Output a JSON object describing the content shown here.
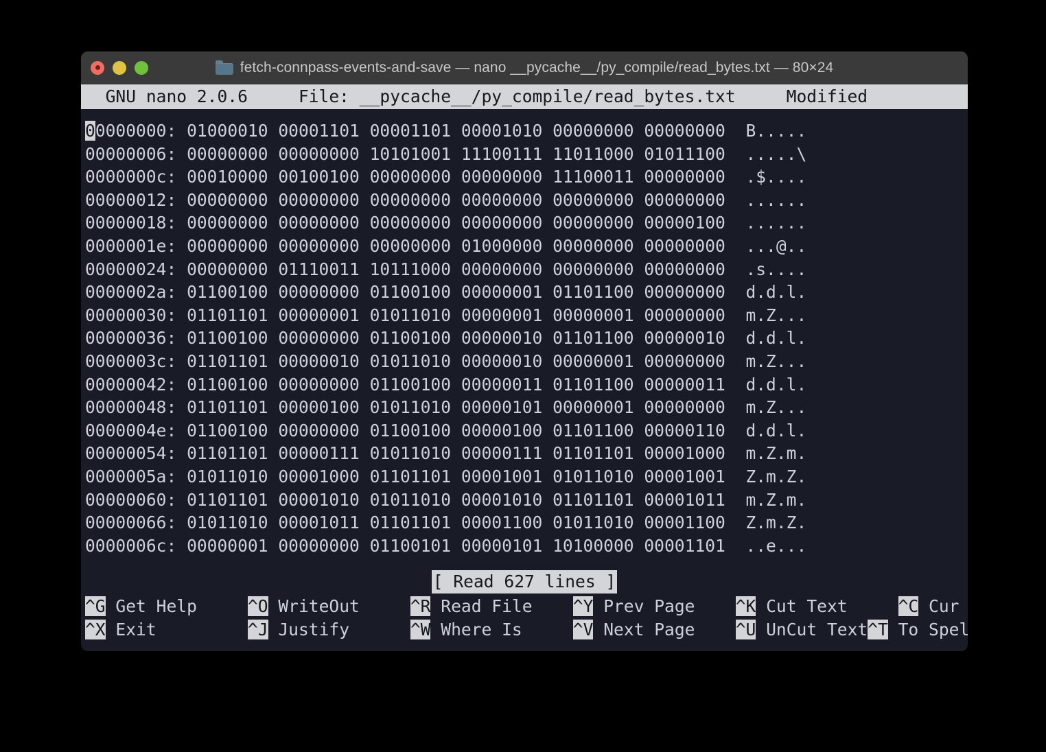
{
  "window": {
    "title": "fetch-connpass-events-and-save — nano __pycache__/py_compile/read_bytes.txt — 80×24",
    "folder_icon": "folder-icon",
    "buttons": {
      "close": "close-button",
      "minimize": "minimize-button",
      "maximize": "maximize-button"
    }
  },
  "nano": {
    "header": {
      "version": "GNU nano 2.0.6",
      "file_label": "File: __pycache__/py_compile/read_bytes.txt",
      "modified": "Modified",
      "full": "  GNU nano 2.0.6     File: __pycache__/py_compile/read_bytes.txt     Modified "
    },
    "status_message": "[ Read 627 lines ]",
    "cursor_char": "0",
    "rows": [
      {
        "offset": "00000000:",
        "bytes": "01000010 00001101 00001101 00001010 00000000 00000000",
        "ascii": "B....."
      },
      {
        "offset": "00000006:",
        "bytes": "00000000 00000000 10101001 11100111 11011000 01011100",
        "ascii": ".....\\"
      },
      {
        "offset": "0000000c:",
        "bytes": "00010000 00100100 00000000 00000000 11100011 00000000",
        "ascii": ".$...."
      },
      {
        "offset": "00000012:",
        "bytes": "00000000 00000000 00000000 00000000 00000000 00000000",
        "ascii": "......"
      },
      {
        "offset": "00000018:",
        "bytes": "00000000 00000000 00000000 00000000 00000000 00000100",
        "ascii": "......"
      },
      {
        "offset": "0000001e:",
        "bytes": "00000000 00000000 00000000 01000000 00000000 00000000",
        "ascii": "...@.."
      },
      {
        "offset": "00000024:",
        "bytes": "00000000 01110011 10111000 00000000 00000000 00000000",
        "ascii": ".s...."
      },
      {
        "offset": "0000002a:",
        "bytes": "01100100 00000000 01100100 00000001 01101100 00000000",
        "ascii": "d.d.l."
      },
      {
        "offset": "00000030:",
        "bytes": "01101101 00000001 01011010 00000001 00000001 00000000",
        "ascii": "m.Z..."
      },
      {
        "offset": "00000036:",
        "bytes": "01100100 00000000 01100100 00000010 01101100 00000010",
        "ascii": "d.d.l."
      },
      {
        "offset": "0000003c:",
        "bytes": "01101101 00000010 01011010 00000010 00000001 00000000",
        "ascii": "m.Z..."
      },
      {
        "offset": "00000042:",
        "bytes": "01100100 00000000 01100100 00000011 01101100 00000011",
        "ascii": "d.d.l."
      },
      {
        "offset": "00000048:",
        "bytes": "01101101 00000100 01011010 00000101 00000001 00000000",
        "ascii": "m.Z..."
      },
      {
        "offset": "0000004e:",
        "bytes": "01100100 00000000 01100100 00000100 01101100 00000110",
        "ascii": "d.d.l."
      },
      {
        "offset": "00000054:",
        "bytes": "01101101 00000111 01011010 00000111 01101101 00001000",
        "ascii": "m.Z.m."
      },
      {
        "offset": "0000005a:",
        "bytes": "01011010 00001000 01101101 00001001 01011010 00001001",
        "ascii": "Z.m.Z."
      },
      {
        "offset": "00000060:",
        "bytes": "01101101 00001010 01011010 00001010 01101101 00001011",
        "ascii": "m.Z.m."
      },
      {
        "offset": "00000066:",
        "bytes": "01011010 00001011 01101101 00001100 01011010 00001100",
        "ascii": "Z.m.Z."
      },
      {
        "offset": "0000006c:",
        "bytes": "00000001 00000000 01100101 00000101 10100000 00001101",
        "ascii": "..e..."
      }
    ],
    "shortcuts": [
      {
        "key": "^G",
        "label": "Get Help",
        "pad": 5
      },
      {
        "key": "^O",
        "label": "WriteOut",
        "pad": 5
      },
      {
        "key": "^R",
        "label": "Read File",
        "pad": 4
      },
      {
        "key": "^Y",
        "label": "Prev Page",
        "pad": 4
      },
      {
        "key": "^K",
        "label": "Cut Text",
        "pad": 5
      },
      {
        "key": "^C",
        "label": "Cur Pos",
        "pad": 0
      },
      {
        "key": "^X",
        "label": "Exit",
        "pad": 9
      },
      {
        "key": "^J",
        "label": "Justify",
        "pad": 6
      },
      {
        "key": "^W",
        "label": "Where Is",
        "pad": 5
      },
      {
        "key": "^V",
        "label": "Next Page",
        "pad": 4
      },
      {
        "key": "^U",
        "label": "UnCut Text",
        "pad": 0
      },
      {
        "key": "^T",
        "label": "To Spell",
        "pad": 0
      }
    ]
  },
  "colors": {
    "terminal_bg": "#191b26",
    "terminal_fg": "#cdd1dc",
    "inverse_bg": "#d4d5d8",
    "inverse_fg": "#16181f",
    "titlebar_bg": "#3a3a3a",
    "desktop_bg": "#000000",
    "close": "#ef6d62",
    "minimize": "#e0c342",
    "maximize": "#70c13e"
  }
}
